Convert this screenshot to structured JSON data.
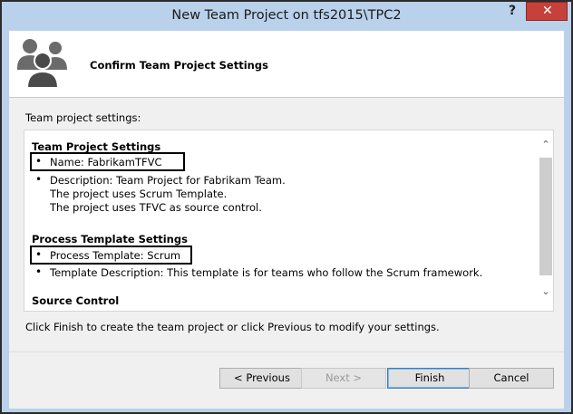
{
  "window": {
    "title": "New Team Project on tfs2015\\TPC2",
    "help_label": "?",
    "close_label": "✕"
  },
  "header": {
    "title": "Confirm Team Project Settings",
    "icon": "team-users-icon"
  },
  "intro_label": "Team project settings:",
  "sections": {
    "team_project": {
      "title": "Team Project Settings",
      "name": "Name: FabrikamTFVC",
      "description_lines": [
        "Description: Team Project for Fabrikam Team.",
        "The project uses Scrum Template.",
        "The project uses TFVC as source control."
      ]
    },
    "process_template": {
      "title": "Process Template Settings",
      "template": "Process Template: Scrum",
      "description": "Template Description: This template is for teams who follow the Scrum framework."
    },
    "source_control": {
      "title": "Source Control"
    }
  },
  "bullet_glyph": "•",
  "scroll": {
    "up": "⌃",
    "down": "⌄"
  },
  "instruction": "Click Finish to create the team project or click Previous to modify your settings.",
  "buttons": {
    "previous": "< Previous",
    "next": "Next >",
    "finish": "Finish",
    "cancel": "Cancel"
  },
  "colors": {
    "title_bar": "#b9d1ea",
    "close_button": "#c7413b",
    "dialog_body": "#f0f0f0"
  }
}
